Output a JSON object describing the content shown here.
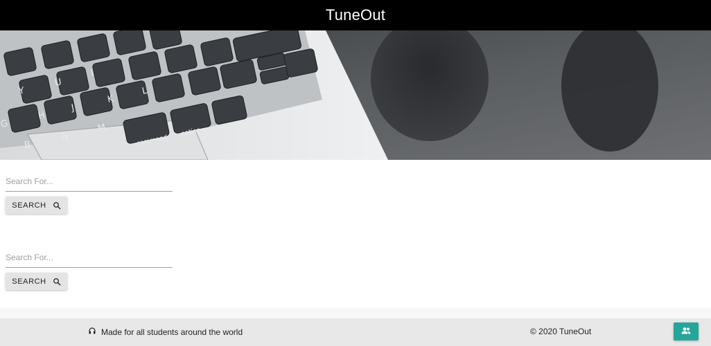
{
  "header": {
    "title": "TuneOut"
  },
  "hero": {
    "image": "laptop-keyboard-photo",
    "key_labels": [
      "Y",
      "U",
      "I",
      "H",
      "J",
      "K",
      "L",
      "G",
      "B",
      "N",
      "M",
      "command",
      "option"
    ]
  },
  "search_forms": [
    {
      "placeholder": "Search For...",
      "value": "",
      "button_label": "SEARCH",
      "button_icon": "search-icon"
    },
    {
      "placeholder": "Search For...",
      "value": "",
      "button_label": "SEARCH",
      "button_icon": "search-icon"
    }
  ],
  "footer": {
    "tagline": "Made for all students around the world",
    "tagline_icon": "headphones-icon",
    "copyright": "© 2020 TuneOut",
    "fab_icon": "people-icon"
  },
  "colors": {
    "header_bg": "#000000",
    "footer_bg": "#e8e8e8",
    "fab_bg": "#26a69a",
    "button_bg": "#e4e4e4"
  }
}
